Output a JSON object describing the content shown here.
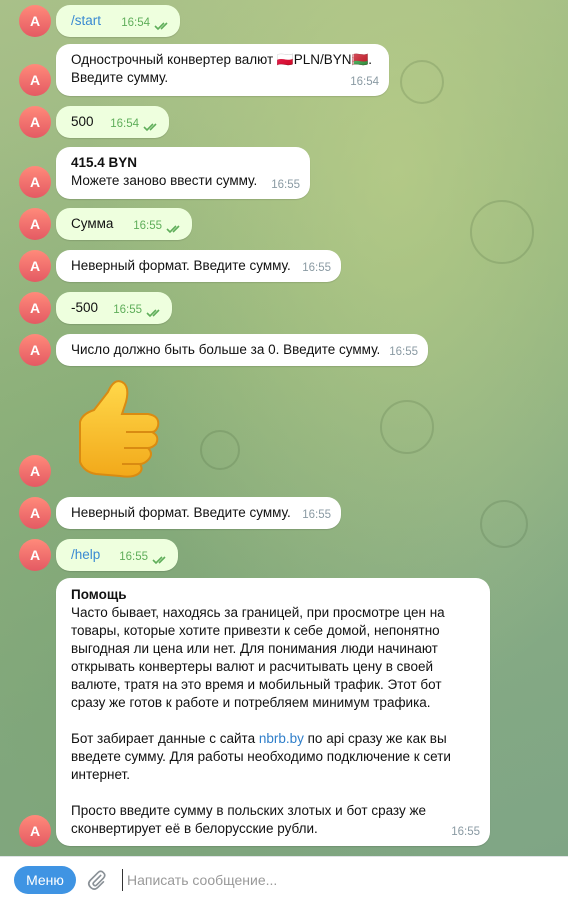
{
  "avatar_letter": "A",
  "messages": [
    {
      "text": "/start",
      "time": "16:54"
    },
    {
      "line1": "Однострочный конвертер валют 🇵🇱PLN/BYN🇧🇾.",
      "line2": "Введите сумму.",
      "time": "16:54"
    },
    {
      "text": "500",
      "time": "16:54"
    },
    {
      "line1": "415.4 BYN",
      "line2": "Можете заново ввести сумму.",
      "time": "16:55"
    },
    {
      "text": "Сумма",
      "time": "16:55"
    },
    {
      "text": "Неверный формат. Введите сумму.",
      "time": "16:55"
    },
    {
      "text": "-500",
      "time": "16:55"
    },
    {
      "text": "Число должно быть больше за 0. Введите сумму.",
      "time": "16:55"
    },
    {
      "sticker": "thumbs-up"
    },
    {
      "text": "Неверный формат. Введите сумму.",
      "time": "16:55"
    },
    {
      "text": "/help",
      "time": "16:55"
    },
    {
      "title": "Помощь",
      "p1": "Часто бывает, находясь за границей, при просмотре цен на товары, которые хотите привезти к себе домой, непонятно выгодная ли цена или нет. Для понимания люди начинают открывать конвертеры валют и расчитывать цену в своей валюте, тратя на это время и мобильный трафик. Этот бот сразу же готов к работе и потребляем минимум трафика.",
      "p2_before": "Бот забирает данные с сайта ",
      "p2_link": "nbrb.by",
      "p2_after": " по api сразу же как вы введете сумму. Для работы необходимо подключение к сети интернет.",
      "p3": "Просто введите сумму в польских злотых и бот сразу же сконвертирует её в белорусские рубли.",
      "time": "16:55"
    }
  ],
  "composer": {
    "menu_label": "Меню",
    "placeholder": "Написать сообщение..."
  },
  "colors": {
    "outgoing_bubble": "#eeffde",
    "menu_button": "#3f94e3",
    "link": "#2f7ec9"
  }
}
